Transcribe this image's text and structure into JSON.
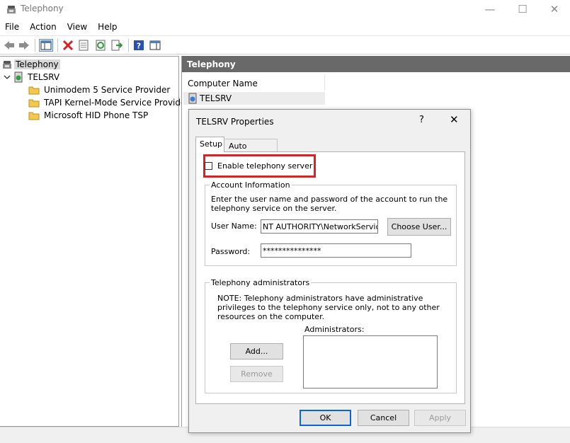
{
  "window": {
    "title": "Telephony",
    "minimize": "—",
    "maximize": "☐",
    "close": "✕"
  },
  "menu": [
    "File",
    "Action",
    "View",
    "Help"
  ],
  "tree": {
    "root": "Telephony",
    "server": "TELSRV",
    "providers": [
      "Unimodem 5 Service Provider",
      "TAPI Kernel-Mode Service Provider",
      "Microsoft HID Phone TSP"
    ]
  },
  "right_pane": {
    "header": "Telephony",
    "column_header": "Computer Name",
    "rows": [
      "TELSRV"
    ]
  },
  "dialog": {
    "title": "TELSRV Properties",
    "help": "?",
    "close": "✕",
    "tabs": [
      "Setup",
      "Auto Updates"
    ],
    "enable_label": "Enable telephony server",
    "account": {
      "legend": "Account Information",
      "description": "Enter the user name and password of the account to run the telephony service on the server.",
      "username_label": "User Name:",
      "username_value": "NT AUTHORITY\\NetworkService",
      "choose_user": "Choose User...",
      "password_label": "Password:",
      "password_value": "***************"
    },
    "admins": {
      "legend": "Telephony administrators",
      "note": "NOTE: Telephony administrators have administrative privileges to the telephony service only, not to any other resources on the computer.",
      "list_label": "Administrators:",
      "add": "Add...",
      "remove": "Remove"
    },
    "ok": "OK",
    "cancel": "Cancel",
    "apply": "Apply"
  },
  "colors": {
    "highlight": "#e02020",
    "header_bg": "#696969",
    "folder": "#f2c94c"
  }
}
